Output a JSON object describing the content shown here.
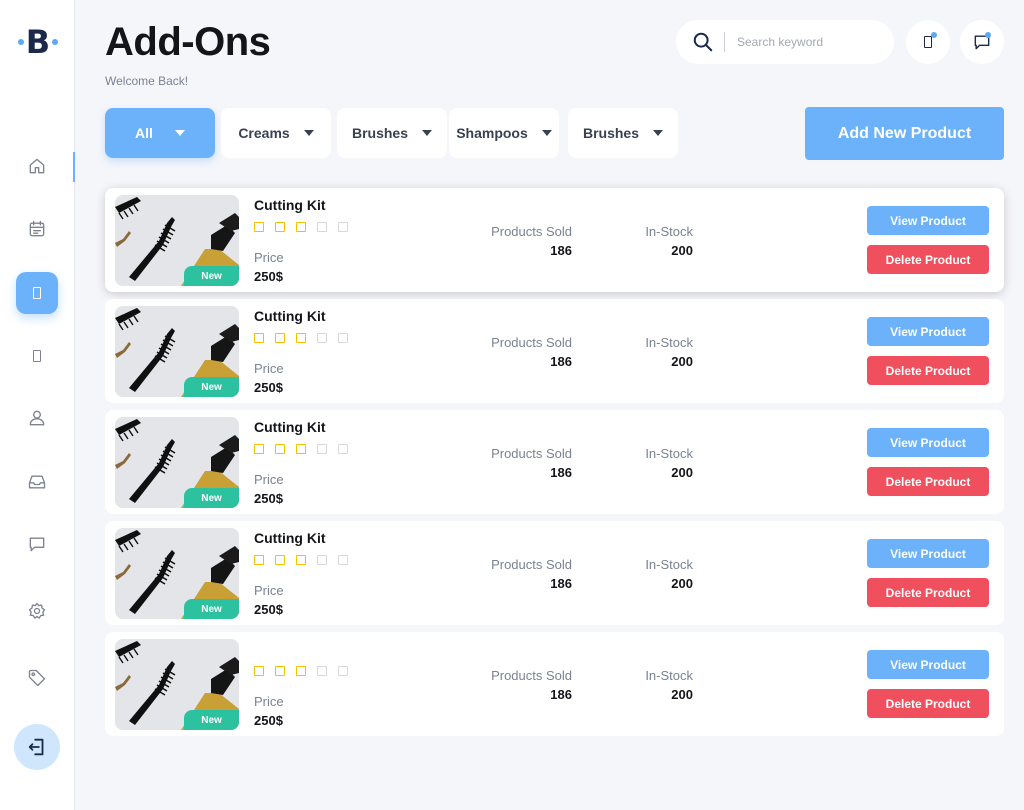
{
  "sidebar": {
    "logo_letter": "B",
    "nav": [
      "home-icon",
      "calendar-icon",
      "product-icon",
      "mobile-icon",
      "user-icon",
      "inbox-icon",
      "chat-icon",
      "settings-icon",
      "tag-icon"
    ],
    "active_index": 2,
    "logout_icon": "logout-icon"
  },
  "header": {
    "title": "Add-Ons",
    "subtitle": "Welcome Back!",
    "search_placeholder": "Search keyword"
  },
  "filters": [
    {
      "label": "All",
      "active": true
    },
    {
      "label": "Creams",
      "active": false
    },
    {
      "label": "Brushes",
      "active": false
    },
    {
      "label": "Shampoos",
      "active": false
    },
    {
      "label": "Brushes",
      "active": false
    }
  ],
  "add_button": "Add New Product",
  "colors": {
    "accent": "#6cb2fb",
    "danger": "#f04f5e",
    "new_tag": "#2cc29f",
    "star": "#f2c200"
  },
  "products": [
    {
      "name": "Cutting Kit",
      "rating": 3,
      "max_rating": 5,
      "price_label": "Price",
      "price": "250$",
      "tag": "New",
      "sold_label": "Products Sold",
      "sold": "186",
      "stock_label": "In-Stock",
      "stock": "200",
      "view": "View Product",
      "delete": "Delete Product"
    },
    {
      "name": "Cutting Kit",
      "rating": 3,
      "max_rating": 5,
      "price_label": "Price",
      "price": "250$",
      "tag": "New",
      "sold_label": "Products Sold",
      "sold": "186",
      "stock_label": "In-Stock",
      "stock": "200",
      "view": "View Product",
      "delete": "Delete Product"
    },
    {
      "name": "Cutting Kit",
      "rating": 3,
      "max_rating": 5,
      "price_label": "Price",
      "price": "250$",
      "tag": "New",
      "sold_label": "Products Sold",
      "sold": "186",
      "stock_label": "In-Stock",
      "stock": "200",
      "view": "View Product",
      "delete": "Delete Product"
    },
    {
      "name": "Cutting Kit",
      "rating": 3,
      "max_rating": 5,
      "price_label": "Price",
      "price": "250$",
      "tag": "New",
      "sold_label": "Products Sold",
      "sold": "186",
      "stock_label": "In-Stock",
      "stock": "200",
      "view": "View Product",
      "delete": "Delete Product"
    },
    {
      "name": "",
      "rating": 3,
      "max_rating": 5,
      "price_label": "Price",
      "price": "250$",
      "tag": "New",
      "sold_label": "Products Sold",
      "sold": "186",
      "stock_label": "In-Stock",
      "stock": "200",
      "view": "View Product",
      "delete": "Delete Product"
    }
  ]
}
